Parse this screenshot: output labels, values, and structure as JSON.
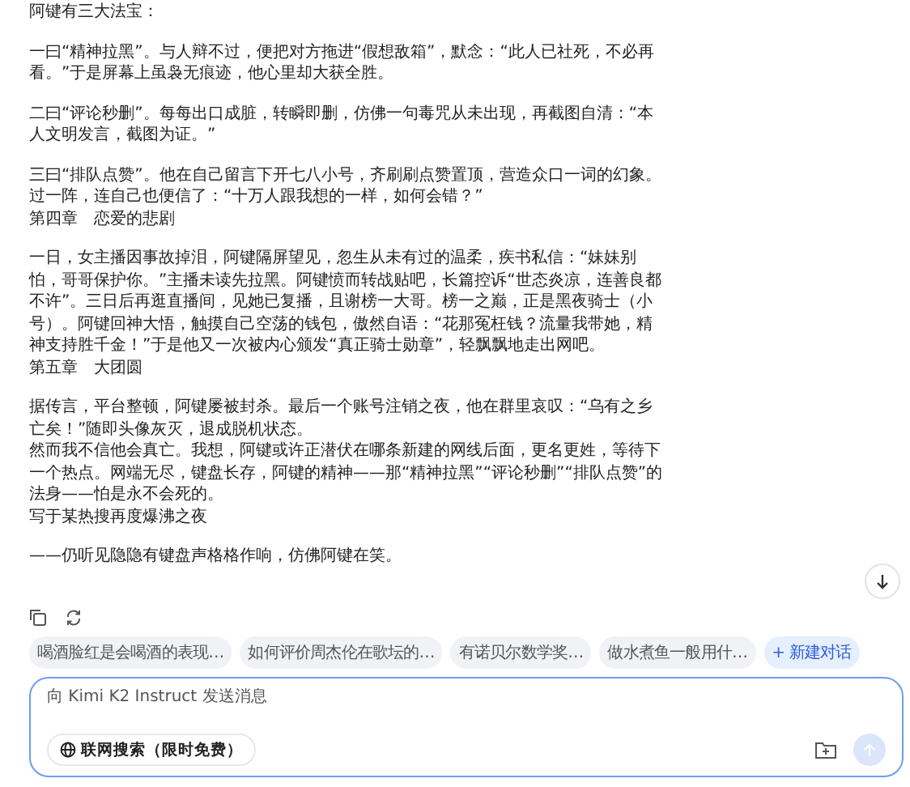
{
  "message": {
    "sections": [
      [
        "阿键有三大法宝："
      ],
      [
        "一曰“精神拉黑”。与人辩不过，便把对方拖进“假想敌箱”，默念：“此人已社死，不必再看。”于是屏幕上虽袅无痕迹，他心里却大获全胜。"
      ],
      [
        "二曰“评论秒删”。每每出口成脏，转瞬即删，仿佛一句毒咒从未出现，再截图自清：“本人文明发言，截图为证。”"
      ],
      [
        "三曰“排队点赞”。他在自己留言下开七八小号，齐刷刷点赞置顶，营造众口一词的幻象。过一阵，连自己也便信了：“十万人跟我想的一样，如何会错？”",
        "第四章　恋爱的悲剧"
      ],
      [
        "一日，女主播因事故掉泪，阿键隔屏望见，忽生从未有过的温柔，疾书私信：“妹妹别怕，哥哥保护你。”主播未读先拉黑。阿键愤而转战贴吧，长篇控诉“世态炎凉，连善良都不许”。三日后再逛直播间，见她已复播，且谢榜一大哥。榜一之巅，正是黑夜骑士（小号）。阿键回神大悟，触摸自己空荡的钱包，傲然自语：“花那冤枉钱？流量我带她，精神支持胜千金！”于是他又一次被内心颁发“真正骑士勋章”，轻飘飘地走出网吧。",
        "第五章　大团圆"
      ],
      [
        "据传言，平台整顿，阿键屡被封杀。最后一个账号注销之夜，他在群里哀叹：“乌有之乡亡矣！”随即头像灰灭，退成脱机状态。",
        "然而我不信他会真亡。我想，阿键或许正潜伏在哪条新建的网线后面，更名更姓，等待下一个热点。网端无尽，键盘长存，阿键的精神——那“精神拉黑”“评论秒删”“排队点赞”的法身——怕是永不会死的。",
        "写于某热搜再度爆沸之夜"
      ],
      [
        "——仍听见隐隐有键盘声格格作响，仿佛阿键在笑。"
      ]
    ]
  },
  "suggestions": [
    "喝酒脸红是会喝酒的表现…",
    "如何评价周杰伦在歌坛的…",
    "有诺贝尔数学奖…",
    "做水煮鱼一般用什…"
  ],
  "new_chat": "+ 新建对话",
  "input": {
    "placeholder": "向 Kimi K2 Instruct 发送消息",
    "web_search": "联网搜索（限时免费）"
  }
}
